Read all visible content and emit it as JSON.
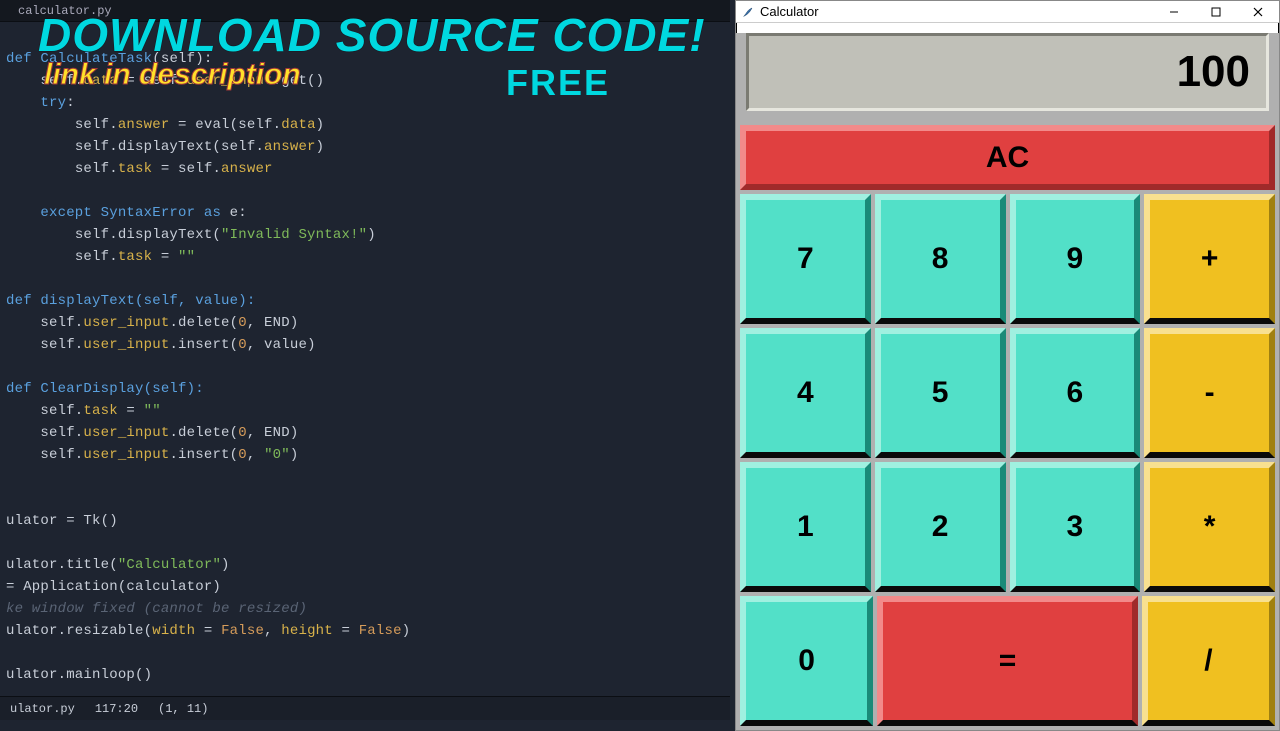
{
  "editor": {
    "tab": "calculator.py",
    "status": {
      "file": "ulator.py",
      "pos": "117:20",
      "sel": "(1, 11)"
    },
    "code": {
      "l1": "def CalculateTask(self):",
      "l2a": "self.",
      "l2b": "data",
      "l2c": " = self.",
      "l2d": "user_input",
      "l2e": ".get()",
      "l3a": "try",
      "l3b": ":",
      "l4a": "self.",
      "l4b": "answer",
      "l4c": " = eval(self.",
      "l4d": "data",
      "l4e": ")",
      "l5a": "self.displayText(self.",
      "l5b": "answer",
      "l5c": ")",
      "l6a": "self.",
      "l6b": "task",
      "l6c": " = self.",
      "l6d": "answer",
      "l7a": "except",
      "l7b": " SyntaxError ",
      "l7c": "as",
      "l7d": " e:",
      "l8a": "self.displayText(",
      "l8b": "\"Invalid Syntax!\"",
      "l8c": ")",
      "l9a": "self.",
      "l9b": "task",
      "l9c": " = ",
      "l9d": "\"\"",
      "l10a": "def",
      "l10b": " displayText(self, value):",
      "l11a": "self.",
      "l11b": "user_input",
      "l11c": ".delete(",
      "l11d": "0",
      "l11e": ", END)",
      "l12a": "self.",
      "l12b": "user_input",
      "l12c": ".insert(",
      "l12d": "0",
      "l12e": ", value)",
      "l13a": "def",
      "l13b": " ClearDisplay(self):",
      "l14a": "self.",
      "l14b": "task",
      "l14c": " = ",
      "l14d": "\"\"",
      "l15a": "self.",
      "l15b": "user_input",
      "l15c": ".delete(",
      "l15d": "0",
      "l15e": ", END)",
      "l16a": "self.",
      "l16b": "user_input",
      "l16c": ".insert(",
      "l16d": "0",
      "l16e": ", ",
      "l16f": "\"0\"",
      "l16g": ")",
      "l17": "ulator = Tk()",
      "l18a": "ulator.title(",
      "l18b": "\"Calculator\"",
      "l18c": ")",
      "l19": "= Application(calculator)",
      "l20": "ke window fixed (cannot be resized)",
      "l21a": "ulator.resizable(",
      "l21b": "width",
      "l21c": " = ",
      "l21d": "False",
      "l21e": ", ",
      "l21f": "height",
      "l21g": " = ",
      "l21h": "False",
      "l21i": ")",
      "l22": "ulator.mainloop()"
    }
  },
  "overlay": {
    "headline": "DOWNLOAD SOURCE CODE!",
    "subline": "link in description",
    "free": "FREE"
  },
  "calc": {
    "title": "Calculator",
    "display": "100",
    "ac": "AC",
    "buttons": {
      "r1": [
        "7",
        "8",
        "9",
        "+"
      ],
      "r2": [
        "4",
        "5",
        "6",
        "-"
      ],
      "r3": [
        "1",
        "2",
        "3",
        "*"
      ],
      "r4": [
        "0",
        "=",
        "/"
      ]
    }
  }
}
